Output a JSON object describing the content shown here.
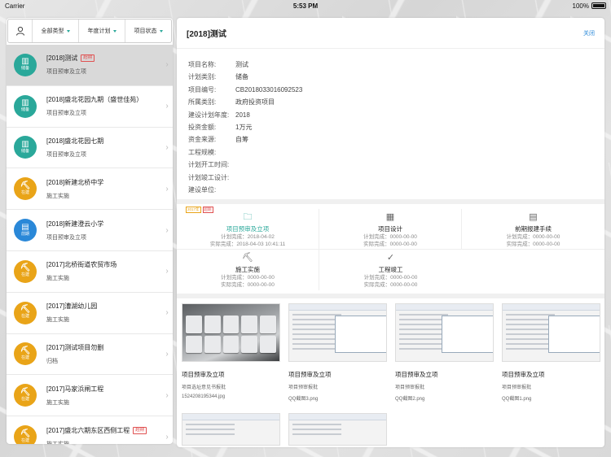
{
  "status_bar": {
    "carrier": "Carrier",
    "time": "5:53 PM",
    "battery": "100%"
  },
  "colors": {
    "teal": "#2aa89a",
    "orange": "#e9a418",
    "blue": "#2a88d8",
    "red": "#e05050"
  },
  "filters": {
    "type": "全部类型",
    "plan": "年度计划",
    "status": "项目状态"
  },
  "list": [
    {
      "title": "[2018]测试",
      "tag": "超期",
      "subtitle": "项目预审及立项",
      "badge": "储备",
      "color": "#2aa89a",
      "icon": "building-icon"
    },
    {
      "title": "[2018]盛北花园九期（盛世佳苑）",
      "tag": "",
      "subtitle": "项目预审及立项",
      "badge": "储备",
      "color": "#2aa89a",
      "icon": "building-icon"
    },
    {
      "title": "[2018]盛北花园七期",
      "tag": "",
      "subtitle": "项目预审及立项",
      "badge": "储备",
      "color": "#2aa89a",
      "icon": "building-icon"
    },
    {
      "title": "[2018]新建北桥中学",
      "tag": "",
      "subtitle": "施工实施",
      "badge": "在建",
      "color": "#e9a418",
      "icon": "crane-icon"
    },
    {
      "title": "[2018]新建澄云小学",
      "tag": "",
      "subtitle": "项目预审及立项",
      "badge": "前期",
      "color": "#2a88d8",
      "icon": "document-icon"
    },
    {
      "title": "[2017]北桥街道农贸市场",
      "tag": "",
      "subtitle": "施工实施",
      "badge": "在建",
      "color": "#e9a418",
      "icon": "crane-icon"
    },
    {
      "title": "[2017]漕湖幼儿园",
      "tag": "",
      "subtitle": "施工实施",
      "badge": "在建",
      "color": "#e9a418",
      "icon": "crane-icon"
    },
    {
      "title": "[2017]测试项目勿删",
      "tag": "",
      "subtitle": "归档",
      "badge": "在建",
      "color": "#e9a418",
      "icon": "crane-icon"
    },
    {
      "title": "[2017]马家浜闸工程",
      "tag": "",
      "subtitle": "施工实施",
      "badge": "在建",
      "color": "#e9a418",
      "icon": "crane-icon"
    },
    {
      "title": "[2017]盛北六期东区西侧工程",
      "tag": "超期",
      "subtitle": "施工实施",
      "badge": "在建",
      "color": "#e9a418",
      "icon": "crane-icon"
    }
  ],
  "detail": {
    "title": "[2018]测试",
    "close": "关闭",
    "fields": [
      {
        "k": "项目名称:",
        "v": "测试"
      },
      {
        "k": "计划类别:",
        "v": "储备"
      },
      {
        "k": "项目编号:",
        "v": "CB2018033016092523"
      },
      {
        "k": "所属类别:",
        "v": "政府投资项目"
      },
      {
        "k": "建设计划年度:",
        "v": "2018"
      },
      {
        "k": "投资金额:",
        "v": "1万元"
      },
      {
        "k": "资金来源:",
        "v": "自筹"
      },
      {
        "k": "工程规模:",
        "v": ""
      },
      {
        "k": "计划开工时间:",
        "v": ""
      },
      {
        "k": "计划竣工设计:",
        "v": ""
      },
      {
        "k": "建设单位:",
        "v": ""
      }
    ],
    "stage_tags": {
      "year": "2017年",
      "overdue": "超期"
    },
    "stages": [
      {
        "name": "项目预审及立项",
        "plan": "计划完成：2018-04-02",
        "actual": "实际完成：2018-04-03 10:41:11",
        "icon": "folder-icon",
        "glyph": "🗀"
      },
      {
        "name": "项目设计",
        "plan": "计划完成：0000-00-00",
        "actual": "实际完成：0000-00-00",
        "icon": "blueprint-icon",
        "glyph": "▦"
      },
      {
        "name": "前期报建手续",
        "plan": "计划完成：0000-00-00",
        "actual": "实际完成：0000-00-00",
        "icon": "clipboard-icon",
        "glyph": "▤"
      },
      {
        "name": "施工实施",
        "plan": "计划完成：0000-00-00",
        "actual": "实际完成：0000-00-00",
        "icon": "wheelbarrow-icon",
        "glyph": "⛏"
      },
      {
        "name": "工程竣工",
        "plan": "计划完成：0000-00-00",
        "actual": "实际完成：0000-00-00",
        "icon": "check-icon",
        "glyph": "✓"
      }
    ],
    "files": [
      {
        "name": "项目预审及立项",
        "desc": "项目选址意见书报批",
        "file": "1524208195344.jpg",
        "kind": "photo"
      },
      {
        "name": "项目预审及立项",
        "desc": "项目预审报批",
        "file": "QQ截图3.png",
        "kind": "shot"
      },
      {
        "name": "项目预审及立项",
        "desc": "项目预审报批",
        "file": "QQ截图2.png",
        "kind": "shot"
      },
      {
        "name": "项目预审及立项",
        "desc": "项目预审报批",
        "file": "QQ截图1.png",
        "kind": "shot"
      }
    ]
  }
}
